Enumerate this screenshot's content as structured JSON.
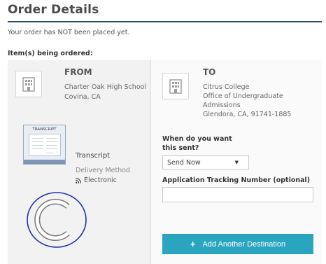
{
  "page": {
    "title": "Order Details",
    "notice": "Your order has NOT been placed yet.",
    "items_label": "Item(s) being ordered:"
  },
  "from": {
    "heading": "FROM",
    "school": "Charter Oak High School",
    "city": "Covina, CA",
    "icon": "building-icon"
  },
  "item": {
    "image_label": "TRANSCRIPT",
    "title": "Transcript",
    "delivery_label": "Delivery Method",
    "delivery_value": "Electronic",
    "delivery_icon": "rss-icon"
  },
  "to": {
    "heading": "TO",
    "lines": [
      "Citrus College",
      "Office of Undergraduate",
      "Admissions",
      "Glendora, CA, 91741-1885"
    ],
    "icon": "building-icon"
  },
  "form": {
    "when_label": "When do you want this sent?",
    "when_selected": "Send Now",
    "tracking_label": "Application Tracking Number (optional)",
    "tracking_value": ""
  },
  "actions": {
    "add_destination": "Add Another Destination"
  },
  "colors": {
    "accent": "#2aa5bf",
    "title_rule": "#2f4a6b",
    "seal_stroke": "#1f2fb0"
  }
}
